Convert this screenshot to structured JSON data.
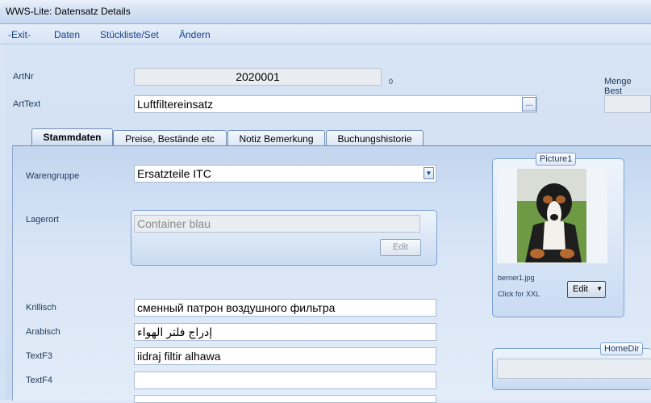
{
  "window": {
    "title": "WWS-Lite: Datensatz Details"
  },
  "menu": {
    "exit": "-Exit-",
    "daten": "Daten",
    "stueckliste": "Stückliste/Set",
    "aendern": "Ändern"
  },
  "header": {
    "artnr_label": "ArtNr",
    "artnr_value": "2020001",
    "artnr_suffix": "0",
    "arttext_label": "ArtText",
    "arttext_value": "Luftfiltereinsatz",
    "ellipsis": "...",
    "menge_label": "Menge Best"
  },
  "tabs": [
    "Stammdaten",
    "Preise, Bestände etc",
    "Notiz Bemerkung",
    "Buchungshistorie"
  ],
  "stammdaten": {
    "warengruppe_label": "Warengruppe",
    "warengruppe_value": "Ersatzteile ITC",
    "lagerort_label": "Lagerort",
    "lagerort_value": "Container blau",
    "lagerort_edit": "Edit",
    "fields": [
      {
        "label": "Krillisch",
        "value": "сменный патрон воздушного фильтра"
      },
      {
        "label": "Arabisch",
        "value": "إدراج فلتر الهواء"
      },
      {
        "label": "TextF3",
        "value": "iidraj filtir alhawa"
      },
      {
        "label": "TextF4",
        "value": ""
      }
    ]
  },
  "picture": {
    "caption": "Picture1",
    "filename": "berner1.jpg",
    "hint": "Click for XXL",
    "edit": "Edit"
  },
  "homedir": {
    "caption": "HomeDir"
  }
}
